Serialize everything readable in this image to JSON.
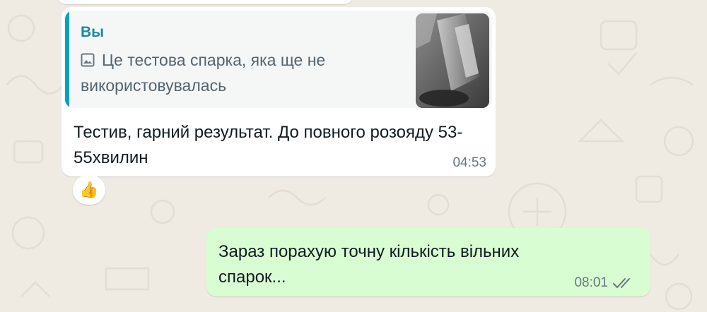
{
  "incoming_message": {
    "quote": {
      "author": "Вы",
      "icon": "photo-icon",
      "text": "Це тестова спарка, яка ще не використовувалась"
    },
    "text": "Тестив, гарний результат. До повного розояду 53-55хвилин",
    "time": "04:53",
    "reaction": "👍"
  },
  "outgoing_message": {
    "text": "Зараз порахую точну кількість вільних спарок...",
    "time": "08:01",
    "status_icon": "double-check-icon"
  },
  "colors": {
    "chat_background": "#efeae2",
    "incoming_bubble": "#ffffff",
    "outgoing_bubble": "#d9fdd3",
    "quote_accent": "#06a3b8",
    "read_ticks": "#667781"
  }
}
